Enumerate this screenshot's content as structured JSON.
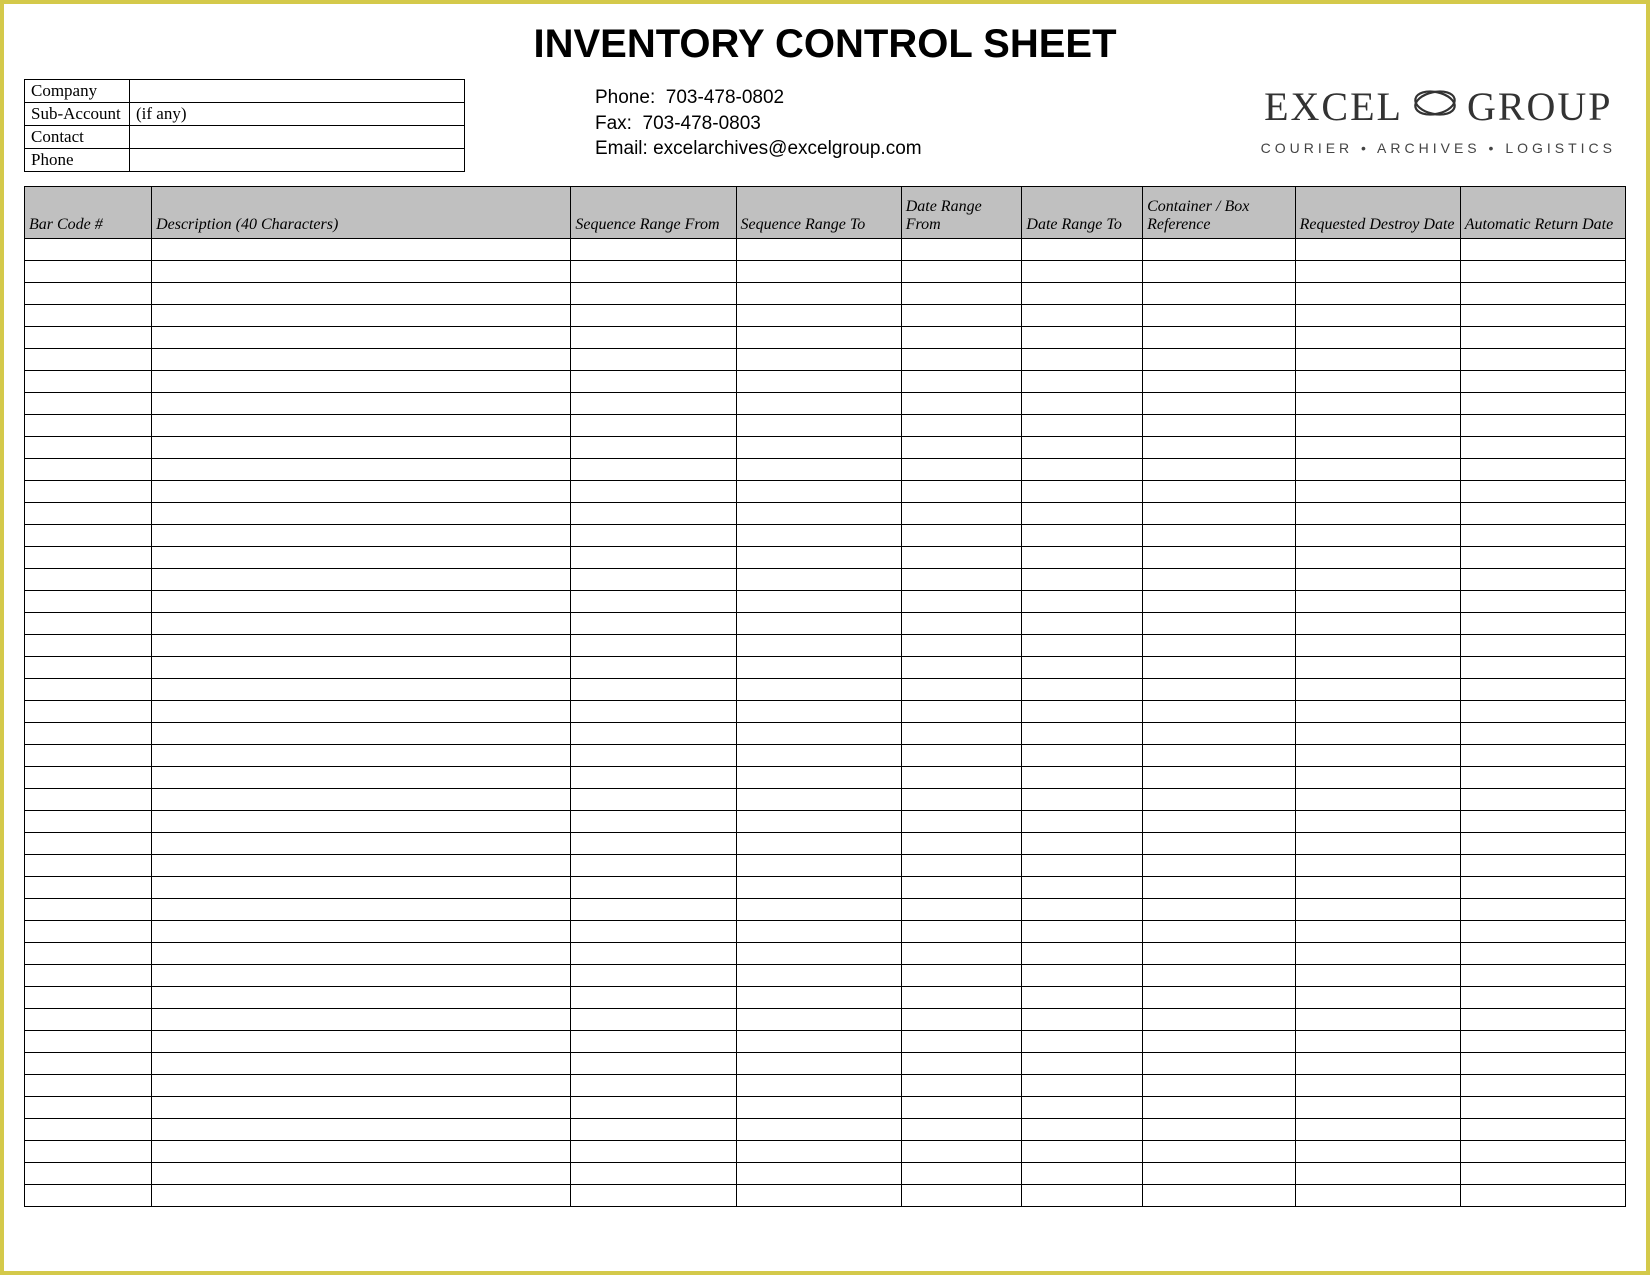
{
  "title": "INVENTORY CONTROL SHEET",
  "info": {
    "rows": [
      {
        "label": "Company",
        "value": ""
      },
      {
        "label": "Sub-Account",
        "value": "(if any)"
      },
      {
        "label": "Contact",
        "value": ""
      },
      {
        "label": "Phone",
        "value": ""
      }
    ]
  },
  "contact": {
    "phone_label": "Phone:",
    "phone": "703-478-0802",
    "fax_label": "Fax:",
    "fax": "703-478-0803",
    "email_label": "Email:",
    "email": "excelarchives@excelgroup.com"
  },
  "logo": {
    "word1": "EXCEL",
    "word2": "GROUP",
    "tagline": "COURIER • ARCHIVES • LOGISTICS"
  },
  "columns": [
    "Bar Code #",
    "Description (40 Characters)",
    "Sequence Range From",
    "Sequence Range To",
    "Date Range From",
    "Date Range To",
    "Container / Box Reference",
    "Requested Destroy Date",
    "Automatic Return Date"
  ],
  "row_count": 44
}
